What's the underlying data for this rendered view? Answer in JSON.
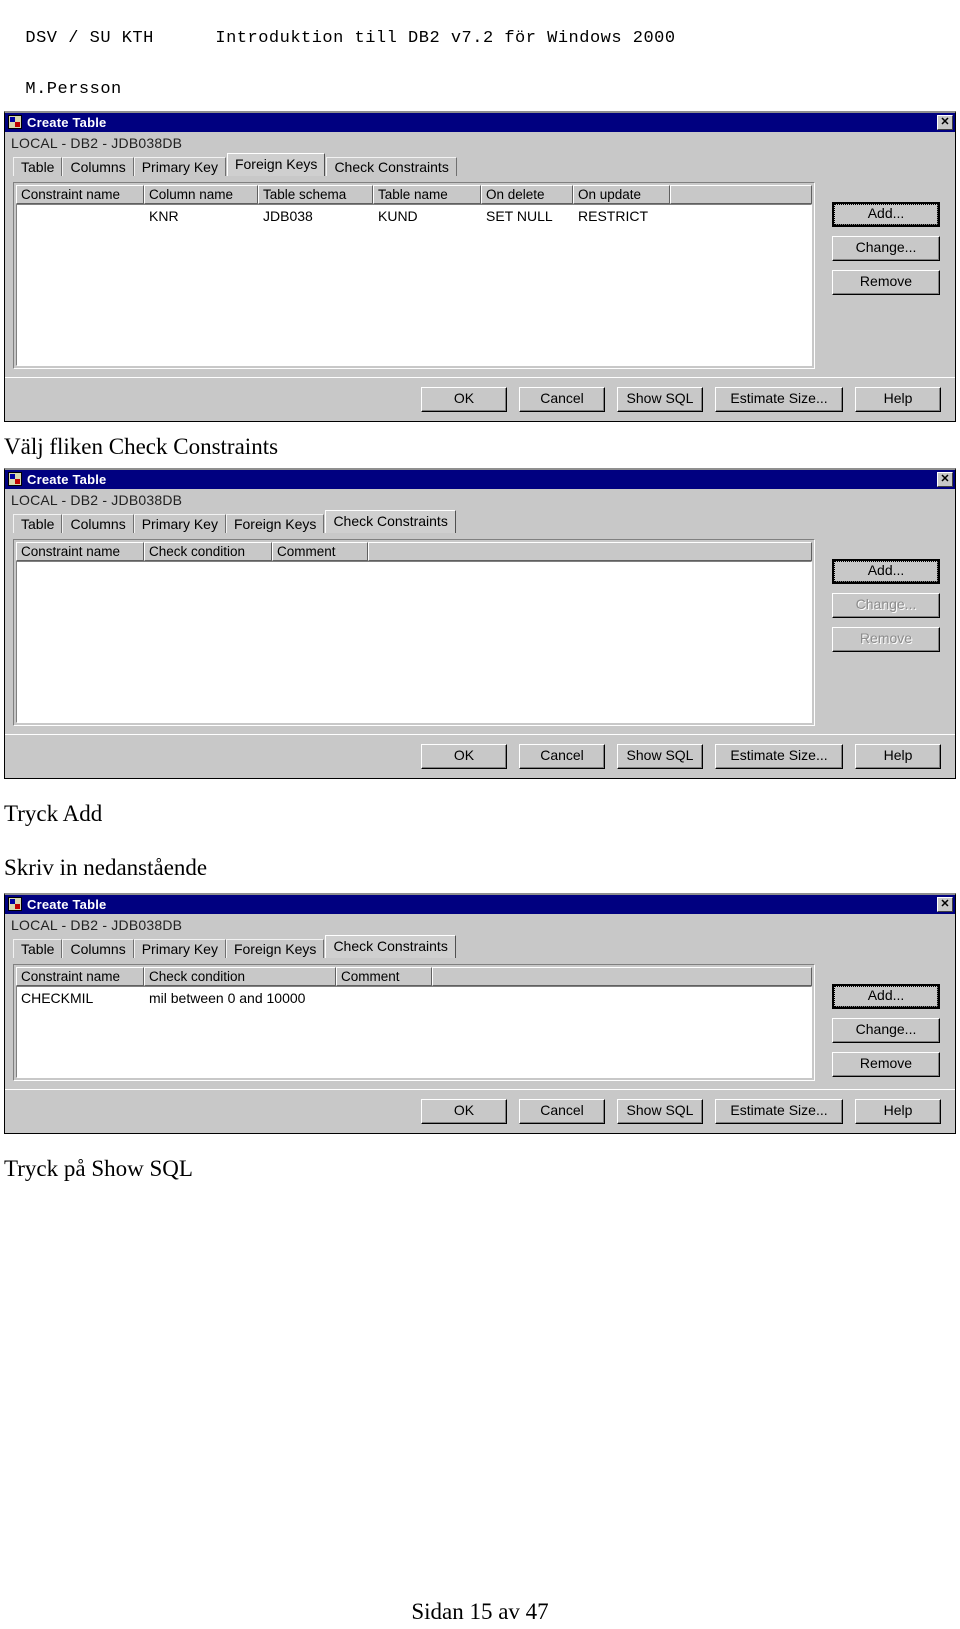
{
  "header": {
    "left": "DSV / SU KTH",
    "title": "Introduktion till DB2 v7.2 för Windows 2000",
    "author": "M.Persson"
  },
  "footer": {
    "page_label": "Sidan 15 av 47"
  },
  "instructions": {
    "after_dialog1": "Välj fliken Check Constraints",
    "after_dialog2_line1": "Tryck Add",
    "after_dialog2_line2": "Skriv in nedanstående",
    "after_dialog3": "Tryck på Show SQL"
  },
  "common": {
    "window_title": "Create Table",
    "subtitle": "LOCAL - DB2 - JDB038DB",
    "close_label": "✕",
    "tabs": [
      "Table",
      "Columns",
      "Primary Key",
      "Foreign Keys",
      "Check Constraints"
    ],
    "side_buttons": [
      "Add...",
      "Change...",
      "Remove"
    ],
    "footer_buttons": [
      "OK",
      "Cancel",
      "Show SQL",
      "Estimate Size...",
      "Help"
    ],
    "colors": {
      "titlebar": "#000080",
      "dialog_face": "#c8c8c8",
      "grid_background": "#ffffff",
      "disabled_text": "#8c8c8c"
    }
  },
  "dialog1": {
    "active_tab": "Foreign Keys",
    "columns": [
      "Constraint name",
      "Column name",
      "Table schema",
      "Table name",
      "On delete",
      "On update"
    ],
    "rows": [
      {
        "constraint_name": "",
        "column_name": "KNR",
        "table_schema": "JDB038",
        "table_name": "KUND",
        "on_delete": "SET NULL",
        "on_update": "RESTRICT"
      }
    ],
    "side_button_states": [
      "focused",
      "enabled",
      "enabled"
    ]
  },
  "dialog2": {
    "active_tab": "Check Constraints",
    "columns": [
      "Constraint name",
      "Check condition",
      "Comment"
    ],
    "rows": [],
    "side_button_states": [
      "focused",
      "disabled",
      "disabled"
    ]
  },
  "dialog3": {
    "active_tab": "Check Constraints",
    "columns": [
      "Constraint name",
      "Check condition",
      "Comment"
    ],
    "rows": [
      {
        "constraint_name": "CHECKMIL",
        "check_condition": "mil between 0 and 10000",
        "comment": ""
      }
    ],
    "side_button_states": [
      "focused",
      "enabled",
      "enabled"
    ]
  }
}
